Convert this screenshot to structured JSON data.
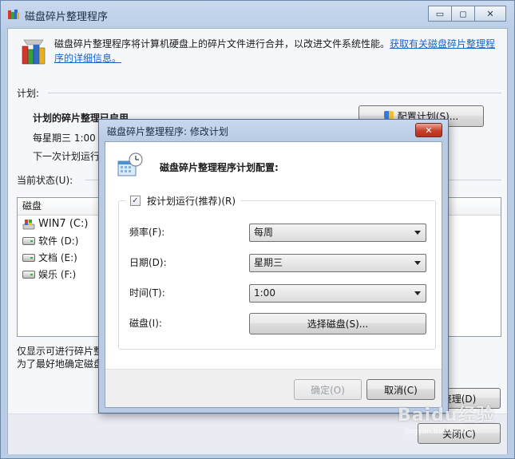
{
  "main": {
    "title": "磁盘碎片整理程序",
    "win_buttons": {
      "minimize": "▭",
      "maximize": "◻",
      "close": "✕"
    },
    "description": "磁盘碎片整理程序将计算机硬盘上的碎片文件进行合并，以改进文件系统性能。",
    "link_text": "获取有关磁盘碎片整理程序的详细信息。",
    "schedule_section": "计划:",
    "schedule_on": "计划的碎片整理已启用",
    "schedule_time": "每星期三  1:00",
    "next_run": "下一次计划运行",
    "configure_button": "配置计划(S)...",
    "current_status": "当前状态(U):",
    "disk_header": "磁盘",
    "disks": [
      {
        "label": "WIN7 (C:)"
      },
      {
        "label": "软件 (D:)"
      },
      {
        "label": "文档 (E:)"
      },
      {
        "label": "娱乐 (F:)"
      }
    ],
    "note1": "仅显示可进行碎片整",
    "note2": "为了最好地确定磁盘",
    "defrag_button": "整理(D)",
    "close_button": "关闭(C)"
  },
  "dialog": {
    "title": "磁盘碎片整理程序: 修改计划",
    "heading": "磁盘碎片整理程序计划配置:",
    "run_on_schedule": "按计划运行(推荐)(R)",
    "run_on_schedule_checked": true,
    "frequency_label": "频率(F):",
    "frequency_value": "每周",
    "day_label": "日期(D):",
    "day_value": "星期三",
    "time_label": "时间(T):",
    "time_value": "1:00",
    "disk_label": "磁盘(I):",
    "select_disks_button": "选择磁盘(S)...",
    "ok_button": "确定(O)",
    "cancel_button": "取消(C)",
    "close_glyph": "✕",
    "check_glyph": "✓"
  },
  "watermark": {
    "text": "Baidu经验",
    "sub": "jingyan.baidu.com"
  },
  "colors": {
    "link": "#1664c9",
    "title_bar": "#c8d8ee",
    "close_red": "#c7402b"
  }
}
